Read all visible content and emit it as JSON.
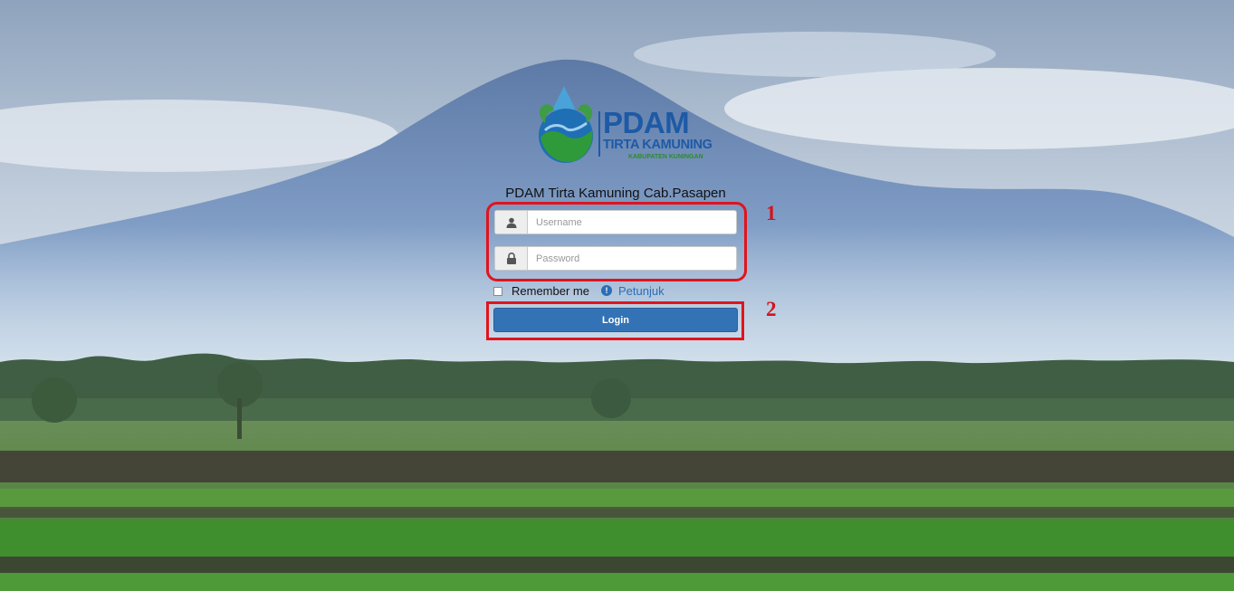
{
  "logo": {
    "main_text": "PDAM",
    "sub_text": "TIRTA KAMUNING",
    "tiny_text": "KABUPATEN KUNINGAN"
  },
  "app_title": "PDAM Tirta Kamuning Cab.Pasapen",
  "username": {
    "placeholder": "Username",
    "value": "",
    "icon": "user-icon"
  },
  "password": {
    "placeholder": "Password",
    "value": "",
    "icon": "lock-icon"
  },
  "remember_me": {
    "label": "Remember me",
    "checked": false
  },
  "hint_link": {
    "label": "Petunjuk",
    "icon": "info-icon"
  },
  "login_button": {
    "label": "Login"
  },
  "annotations": [
    "1",
    "2"
  ],
  "colors": {
    "accent": "#3373b5",
    "highlight": "#e0141e",
    "link": "#2a6fb6"
  }
}
